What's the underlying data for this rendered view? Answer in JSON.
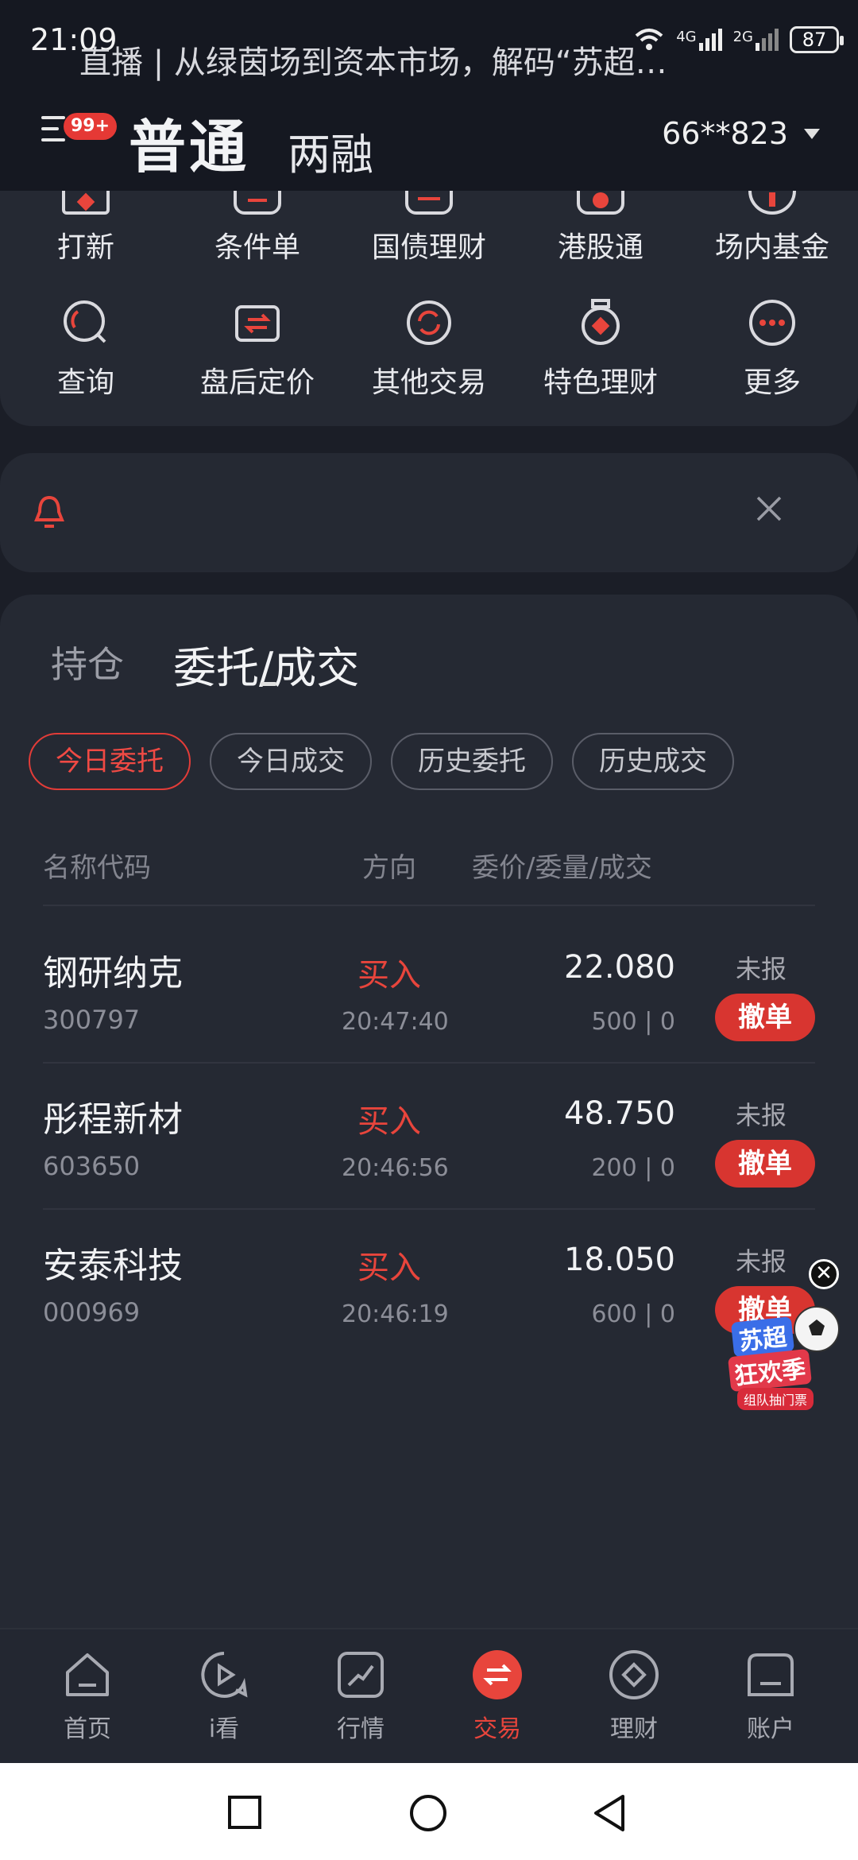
{
  "status_bar": {
    "time": "21:09",
    "network_4g": "4G",
    "network_2g": "2G",
    "battery": "87"
  },
  "header": {
    "menu_badge": "99+",
    "title": "普通",
    "subtitle": "两融",
    "account": "66**823"
  },
  "quick_grid": {
    "row1": [
      "打新",
      "条件单",
      "国债理财",
      "港股通",
      "场内基金"
    ],
    "row2": [
      "查询",
      "盘后定价",
      "其他交易",
      "特色理财",
      "更多"
    ]
  },
  "notice": {
    "text": "直播 | 从绿茵场到资本市场，解码“苏超…"
  },
  "orders": {
    "tab_holdings": "持仓",
    "tab_orders": "委托/成交",
    "filters": [
      "今日委托",
      "今日成交",
      "历史委托",
      "历史成交"
    ],
    "active_filter": "今日委托",
    "columns": {
      "name": "名称代码",
      "direction": "方向",
      "price": "委价/委量/成交"
    },
    "rows": [
      {
        "name": "钢研纳克",
        "code": "300797",
        "direction": "买入",
        "time": "20:47:40",
        "price": "22.080",
        "qty": "500 | 0",
        "status": "未报",
        "action": "撤单"
      },
      {
        "name": "彤程新材",
        "code": "603650",
        "direction": "买入",
        "time": "20:46:56",
        "price": "48.750",
        "qty": "200 | 0",
        "status": "未报",
        "action": "撤单"
      },
      {
        "name": "安泰科技",
        "code": "000969",
        "direction": "买入",
        "time": "20:46:19",
        "price": "18.050",
        "qty": "600 | 0",
        "status": "未报",
        "action": "撤单"
      }
    ]
  },
  "promo": {
    "line1": "苏超",
    "line2": "狂欢季",
    "line3": "组队抽门票"
  },
  "bottom_nav": [
    "首页",
    "i看",
    "行情",
    "交易",
    "理财",
    "账户"
  ],
  "active_nav": "交易",
  "colors": {
    "accent_red": "#e8453c",
    "background": "#1b1e27",
    "card": "#252933"
  }
}
